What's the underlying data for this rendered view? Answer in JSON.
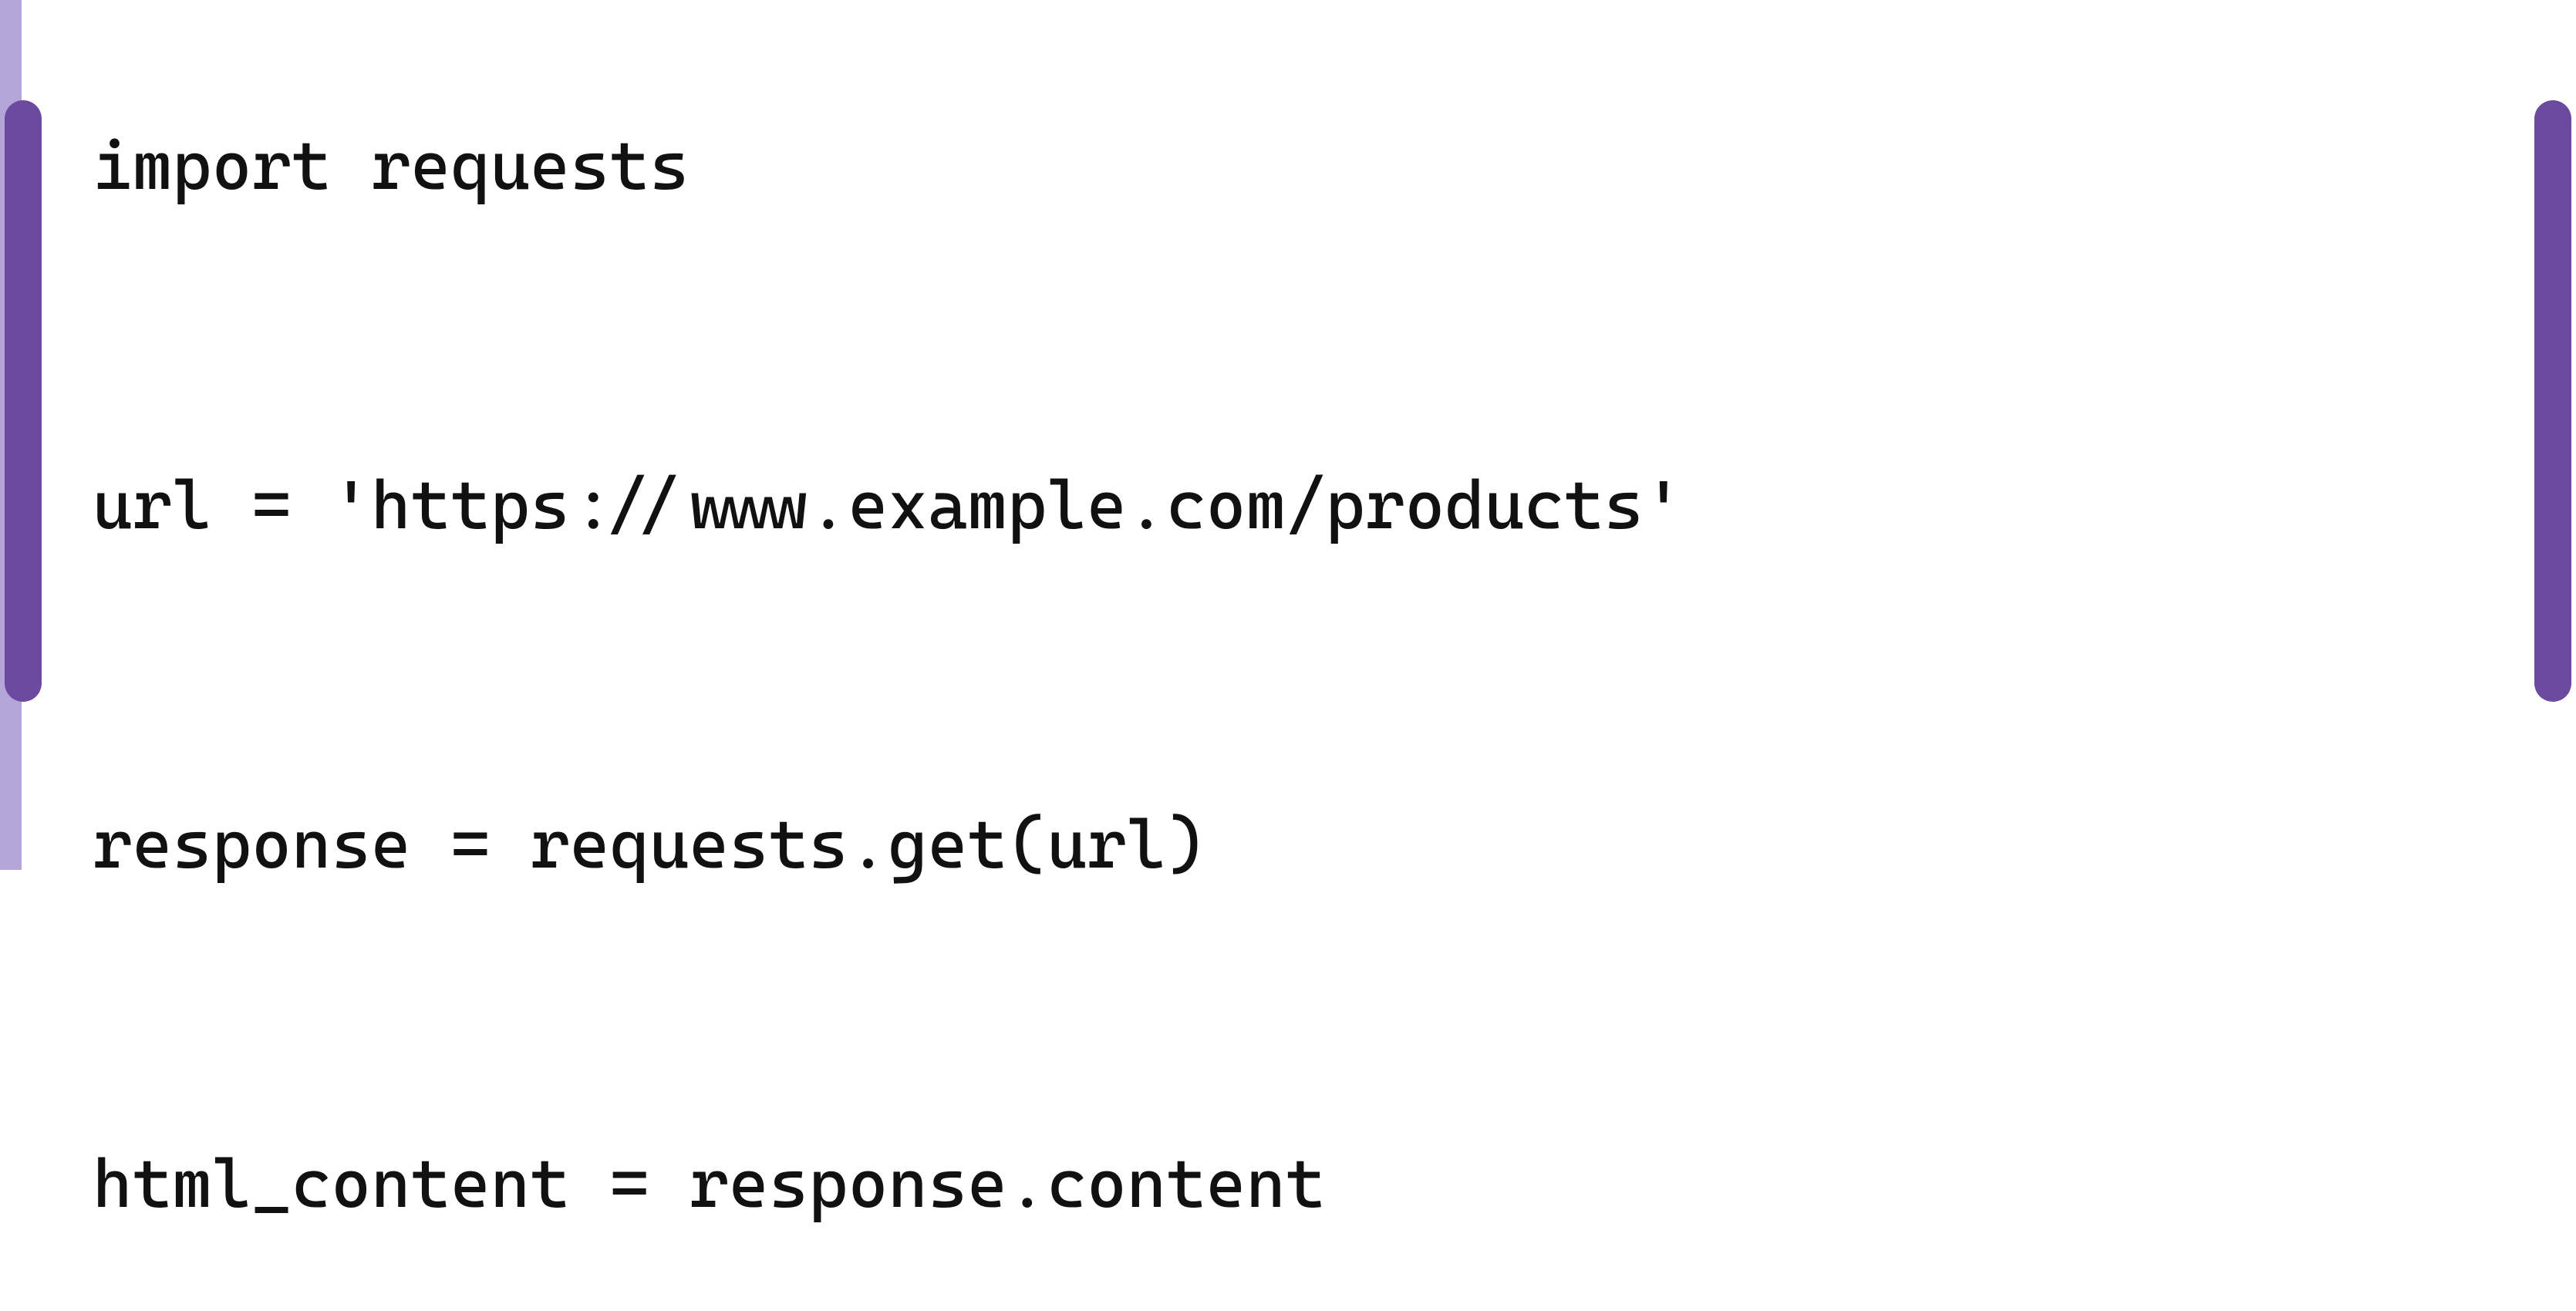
{
  "code": {
    "lines": [
      "import requests",
      "",
      "url = 'https://www.example.com/products'",
      "",
      "response = requests.get(url)",
      "",
      "html_content = response.content"
    ]
  },
  "colors": {
    "rail_light": "#b4a6d6",
    "thumb": "#6b4aa0",
    "text": "#111111",
    "background": "#ffffff"
  }
}
